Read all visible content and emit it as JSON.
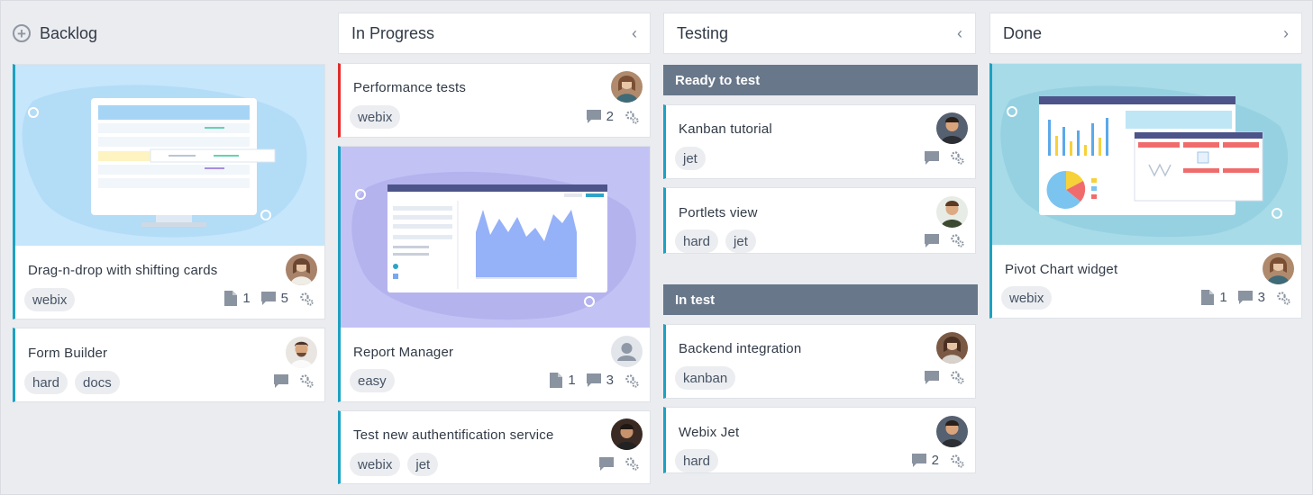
{
  "columns": {
    "backlog": {
      "title": "Backlog"
    },
    "in_progress": {
      "title": "In Progress",
      "arrow": "‹"
    },
    "testing": {
      "title": "Testing",
      "arrow": "‹"
    },
    "done": {
      "title": "Done",
      "arrow": "›"
    }
  },
  "groups": {
    "ready": "Ready to test",
    "in_test": "In test"
  },
  "cards": {
    "drag": {
      "title": "Drag-n-drop with shifting cards",
      "tags": [
        "webix"
      ],
      "attachments": "1",
      "comments": "5"
    },
    "form": {
      "title": "Form Builder",
      "tags": [
        "hard",
        "docs"
      ]
    },
    "perf": {
      "title": "Performance tests",
      "tags": [
        "webix"
      ],
      "comments": "2"
    },
    "report": {
      "title": "Report Manager",
      "tags": [
        "easy"
      ],
      "attachments": "1",
      "comments": "3"
    },
    "auth": {
      "title": "Test new authentification service",
      "tags": [
        "webix",
        "jet"
      ]
    },
    "kanban": {
      "title": "Kanban tutorial",
      "tags": [
        "jet"
      ]
    },
    "portlets": {
      "title": "Portlets view",
      "tags": [
        "hard",
        "jet"
      ]
    },
    "backend": {
      "title": "Backend integration",
      "tags": [
        "kanban"
      ]
    },
    "jet": {
      "title": "Webix Jet",
      "tags": [
        "hard"
      ],
      "comments": "2"
    },
    "pivot": {
      "title": "Pivot Chart widget",
      "tags": [
        "webix"
      ],
      "attachments": "1",
      "comments": "3"
    }
  },
  "colors": {
    "accent": "#1ca1c1",
    "priority_high": "#e02b2b",
    "group_header": "#68778a",
    "background": "#ebecf0"
  },
  "icons": {
    "add": "plus-circle-icon",
    "attachment": "file-icon",
    "comment": "comment-icon",
    "menu": "gear-icon"
  }
}
